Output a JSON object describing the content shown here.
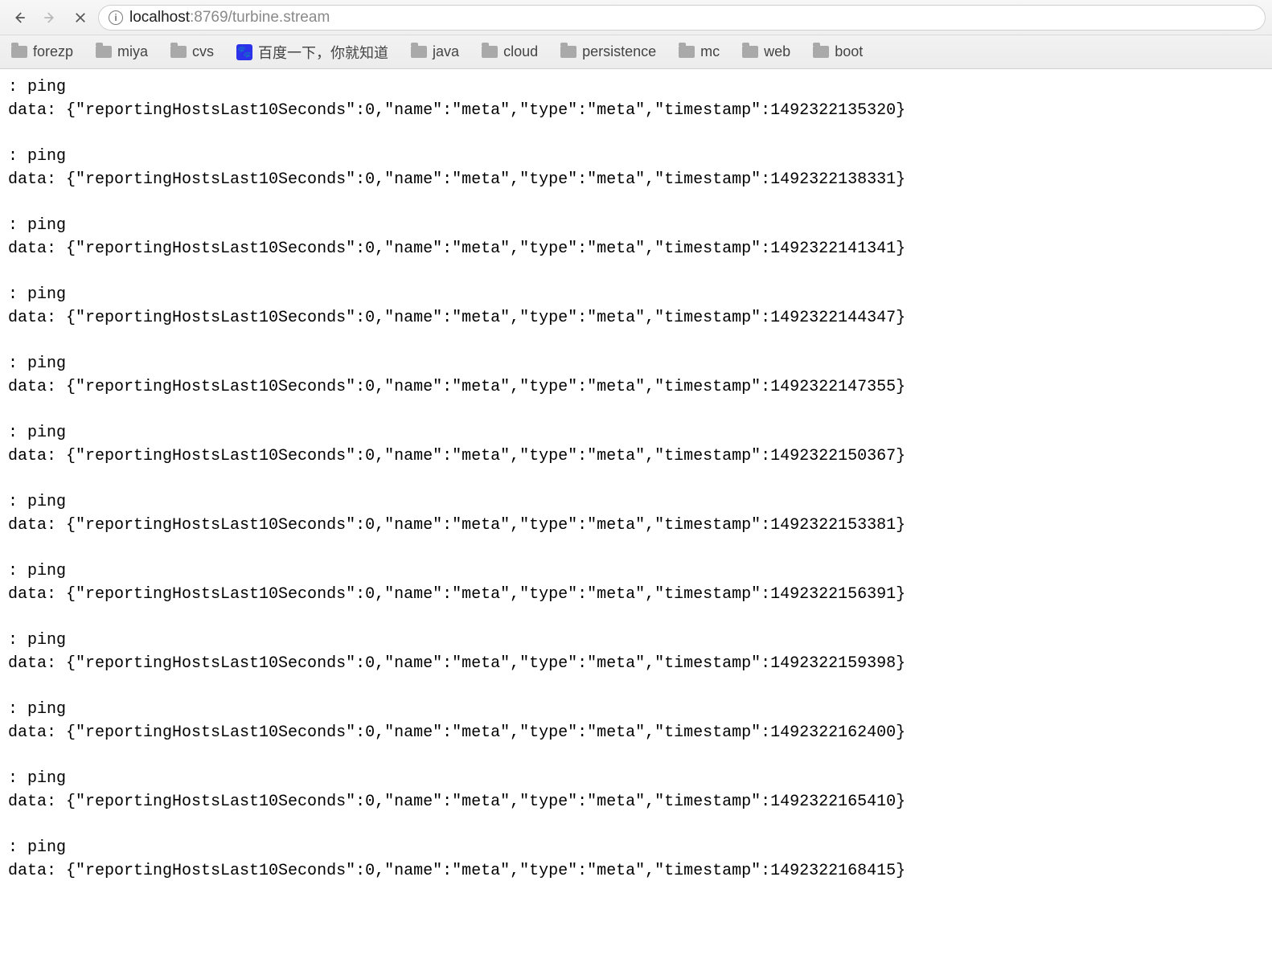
{
  "toolbar": {
    "url_host": "localhost",
    "url_port_path": ":8769/turbine.stream"
  },
  "bookmarks": [
    {
      "label": "forezp",
      "icon": "folder"
    },
    {
      "label": "miya",
      "icon": "folder"
    },
    {
      "label": "cvs",
      "icon": "folder"
    },
    {
      "label": "百度一下，你就知道",
      "icon": "baidu"
    },
    {
      "label": "java",
      "icon": "folder"
    },
    {
      "label": "cloud",
      "icon": "folder"
    },
    {
      "label": "persistence",
      "icon": "folder"
    },
    {
      "label": "mc",
      "icon": "folder"
    },
    {
      "label": "web",
      "icon": "folder"
    },
    {
      "label": "boot",
      "icon": "folder"
    }
  ],
  "stream": [
    {
      "ping": ": ping",
      "data": "data: {\"reportingHostsLast10Seconds\":0,\"name\":\"meta\",\"type\":\"meta\",\"timestamp\":1492322135320}"
    },
    {
      "ping": ": ping",
      "data": "data: {\"reportingHostsLast10Seconds\":0,\"name\":\"meta\",\"type\":\"meta\",\"timestamp\":1492322138331}"
    },
    {
      "ping": ": ping",
      "data": "data: {\"reportingHostsLast10Seconds\":0,\"name\":\"meta\",\"type\":\"meta\",\"timestamp\":1492322141341}"
    },
    {
      "ping": ": ping",
      "data": "data: {\"reportingHostsLast10Seconds\":0,\"name\":\"meta\",\"type\":\"meta\",\"timestamp\":1492322144347}"
    },
    {
      "ping": ": ping",
      "data": "data: {\"reportingHostsLast10Seconds\":0,\"name\":\"meta\",\"type\":\"meta\",\"timestamp\":1492322147355}"
    },
    {
      "ping": ": ping",
      "data": "data: {\"reportingHostsLast10Seconds\":0,\"name\":\"meta\",\"type\":\"meta\",\"timestamp\":1492322150367}"
    },
    {
      "ping": ": ping",
      "data": "data: {\"reportingHostsLast10Seconds\":0,\"name\":\"meta\",\"type\":\"meta\",\"timestamp\":1492322153381}"
    },
    {
      "ping": ": ping",
      "data": "data: {\"reportingHostsLast10Seconds\":0,\"name\":\"meta\",\"type\":\"meta\",\"timestamp\":1492322156391}"
    },
    {
      "ping": ": ping",
      "data": "data: {\"reportingHostsLast10Seconds\":0,\"name\":\"meta\",\"type\":\"meta\",\"timestamp\":1492322159398}"
    },
    {
      "ping": ": ping",
      "data": "data: {\"reportingHostsLast10Seconds\":0,\"name\":\"meta\",\"type\":\"meta\",\"timestamp\":1492322162400}"
    },
    {
      "ping": ": ping",
      "data": "data: {\"reportingHostsLast10Seconds\":0,\"name\":\"meta\",\"type\":\"meta\",\"timestamp\":1492322165410}"
    },
    {
      "ping": ": ping",
      "data": "data: {\"reportingHostsLast10Seconds\":0,\"name\":\"meta\",\"type\":\"meta\",\"timestamp\":1492322168415}"
    }
  ]
}
